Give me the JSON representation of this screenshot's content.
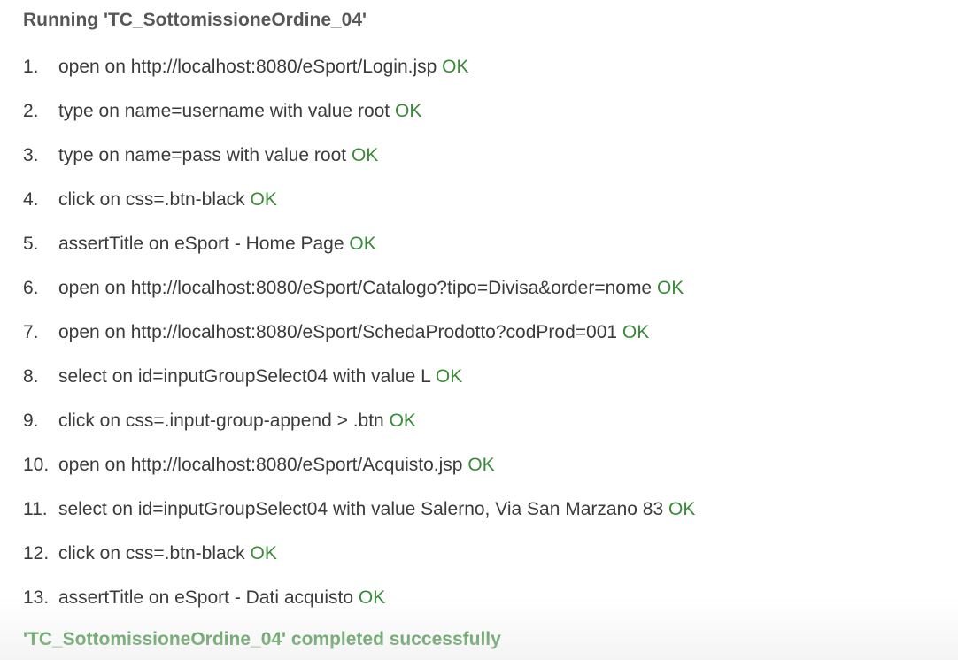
{
  "log": {
    "title": "Running 'TC_SottomissioneOrdine_04'",
    "steps": [
      {
        "num": "1.",
        "text": "open on http://localhost:8080/eSport/Login.jsp",
        "status": "OK"
      },
      {
        "num": "2.",
        "text": "type on name=username with value root",
        "status": "OK"
      },
      {
        "num": "3.",
        "text": "type on name=pass with value root",
        "status": "OK"
      },
      {
        "num": "4.",
        "text": "click on css=.btn-black",
        "status": "OK"
      },
      {
        "num": "5.",
        "text": "assertTitle on eSport - Home Page",
        "status": "OK"
      },
      {
        "num": "6.",
        "text": "open on http://localhost:8080/eSport/Catalogo?tipo=Divisa&order=nome",
        "status": "OK"
      },
      {
        "num": "7.",
        "text": "open on http://localhost:8080/eSport/SchedaProdotto?codProd=001",
        "status": "OK"
      },
      {
        "num": "8.",
        "text": "select on id=inputGroupSelect04 with value L",
        "status": "OK"
      },
      {
        "num": "9.",
        "text": "click on css=.input-group-append > .btn",
        "status": "OK"
      },
      {
        "num": "10.",
        "text": "open on http://localhost:8080/eSport/Acquisto.jsp",
        "status": "OK"
      },
      {
        "num": "11.",
        "text": "select on id=inputGroupSelect04 with value Salerno, Via San Marzano 83",
        "status": "OK"
      },
      {
        "num": "12.",
        "text": "click on css=.btn-black",
        "status": "OK"
      },
      {
        "num": "13.",
        "text": "assertTitle on eSport - Dati acquisto",
        "status": "OK"
      }
    ],
    "completion": "'TC_SottomissioneOrdine_04' completed successfully"
  },
  "colors": {
    "ok": "#3a8a3a",
    "text": "#3b3b3b",
    "title": "#575757",
    "background": "#ffffff"
  }
}
